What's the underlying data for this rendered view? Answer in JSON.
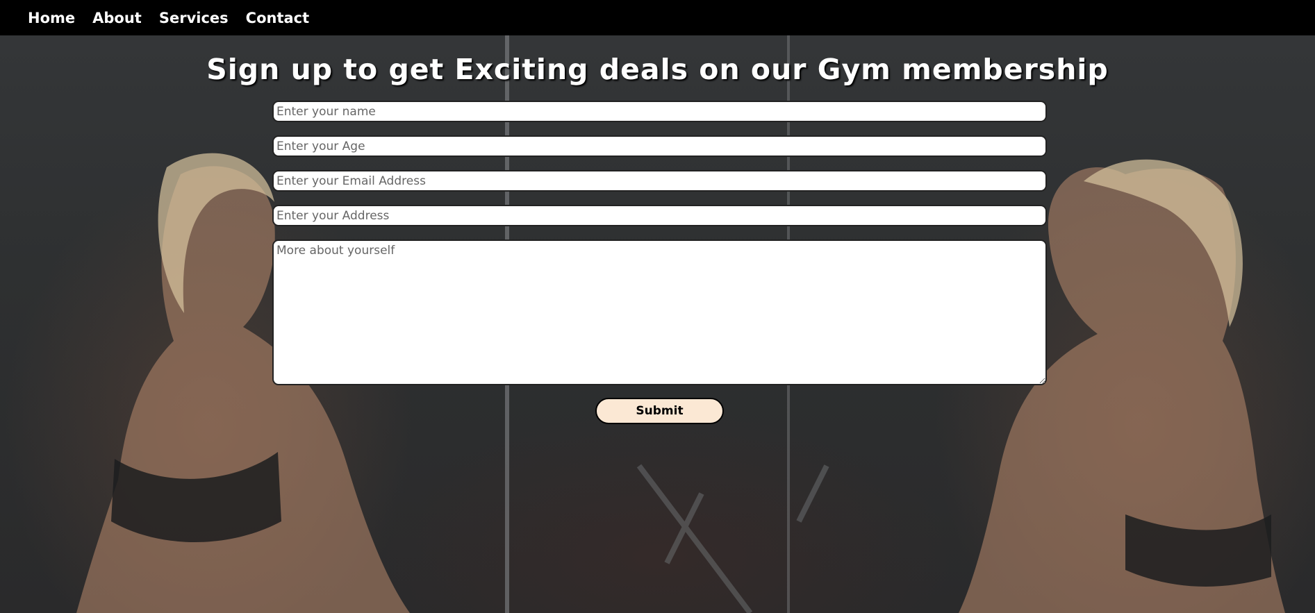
{
  "nav": {
    "items": [
      {
        "label": "Home"
      },
      {
        "label": "About"
      },
      {
        "label": "Services"
      },
      {
        "label": "Contact"
      }
    ]
  },
  "form": {
    "title": "Sign up to get Exciting deals on our Gym membership",
    "name_placeholder": "Enter your name",
    "age_placeholder": "Enter your Age",
    "email_placeholder": "Enter your Email Address",
    "address_placeholder": "Enter your Address",
    "about_placeholder": "More about yourself",
    "submit_label": "Submit"
  },
  "colors": {
    "navbar": "#000000",
    "submit_bg": "#fbe8d4",
    "title_text": "#ffffff"
  }
}
